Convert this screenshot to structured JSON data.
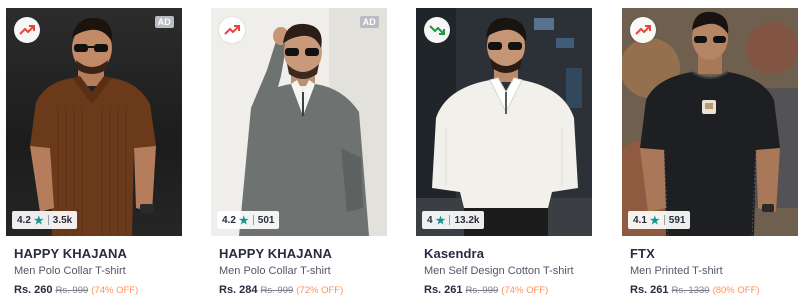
{
  "products": [
    {
      "brand": "HAPPY KHAJANA",
      "description": "Men Polo Collar T-shirt",
      "price": "Rs. 260",
      "mrp": "Rs. 999",
      "discount": "(74% OFF)",
      "rating": "4.2",
      "rating_count": "3.5k",
      "ad_label": "AD",
      "trend_icon": "trending-up-icon",
      "trend_color": "#e8453c",
      "shirt_color": "#6b3a1b"
    },
    {
      "brand": "HAPPY KHAJANA",
      "description": "Men Polo Collar T-shirt",
      "price": "Rs. 284",
      "mrp": "Rs. 999",
      "discount": "(72% OFF)",
      "rating": "4.2",
      "rating_count": "501",
      "ad_label": "AD",
      "trend_icon": "trending-up-icon",
      "trend_color": "#e8453c",
      "shirt_color": "#6e7270"
    },
    {
      "brand": "Kasendra",
      "description": "Men Self Design Cotton T-shirt",
      "price": "Rs. 261",
      "mrp": "Rs. 999",
      "discount": "(74% OFF)",
      "rating": "4",
      "rating_count": "13.2k",
      "trend_icon": "trending-down-icon",
      "trend_color": "#1a9a3c",
      "shirt_color": "#f2f0ea"
    },
    {
      "brand": "FTX",
      "description": "Men Printed T-shirt",
      "price": "Rs. 261",
      "mrp": "Rs. 1330",
      "discount": "(80% OFF)",
      "rating": "4.1",
      "rating_count": "591",
      "trend_icon": "trending-up-icon",
      "trend_color": "#e8453c",
      "shirt_color": "#1d1f22"
    }
  ],
  "colors": {
    "rating_star": "#14958f",
    "discount": "#ff905a",
    "brand_text": "#282c3f"
  }
}
